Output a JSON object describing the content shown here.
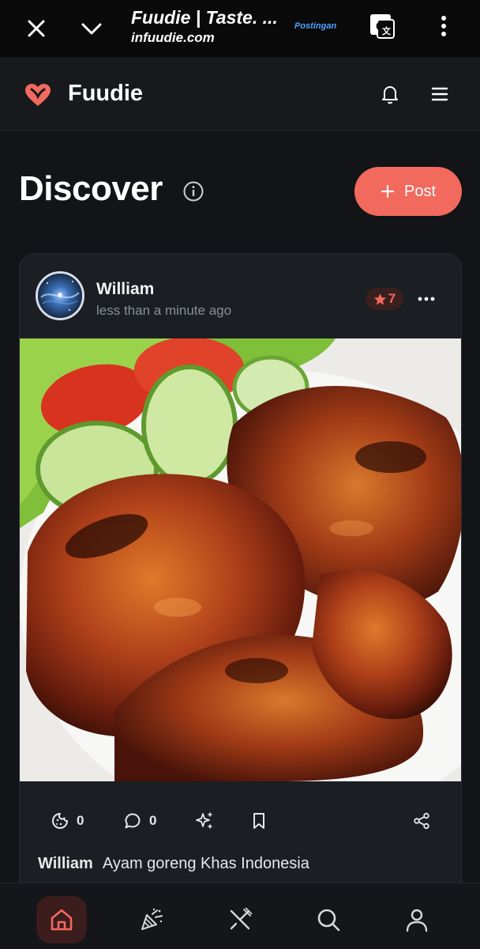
{
  "browser": {
    "title": "Fuudie | Taste. ...",
    "url": "infuudie.com",
    "badge": "Postingan",
    "icons": [
      "close-icon",
      "chevron-down-icon",
      "translate-icon",
      "more-vertical-icon"
    ]
  },
  "appbar": {
    "brand": "Fuudie",
    "icons": [
      "fuudie-logo",
      "bell-icon",
      "menu-icon"
    ]
  },
  "page": {
    "title": "Discover",
    "post_button": "Post"
  },
  "post": {
    "author": "William",
    "time": "less than a minute ago",
    "rating": "7",
    "likes": "0",
    "comments": "0",
    "caption_author": "William",
    "caption_text": "Ayam goreng Khas Indonesia"
  },
  "bottom_nav": {
    "items": [
      "home",
      "celebrate",
      "dining",
      "search",
      "profile"
    ],
    "active": "home"
  },
  "colors": {
    "accent": "#f2695e",
    "background": "#121418",
    "card": "#1b1e23"
  }
}
